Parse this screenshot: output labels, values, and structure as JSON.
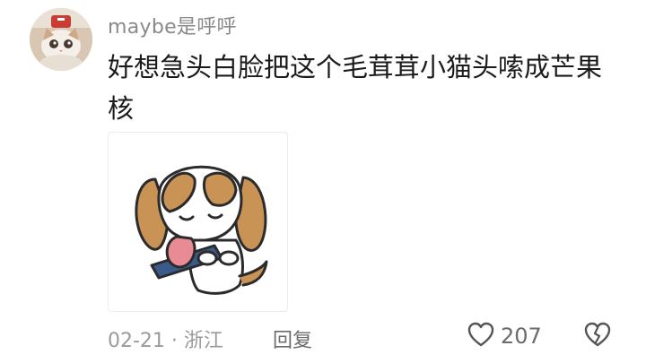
{
  "comment": {
    "username": "maybe是呼呼",
    "text": "好想急头白脸把这个毛茸茸小猫头嗦成芒果核",
    "date_location": "02-21 · 浙江",
    "reply_label": "回复",
    "like_count": "207",
    "icons": {
      "like": "heart-outline-icon",
      "dislike": "broken-heart-icon"
    }
  },
  "colors": {
    "username": "#8a8a8a",
    "text": "#1b1b1b",
    "meta": "#9a9a9a",
    "action": "#6b6b6b"
  }
}
